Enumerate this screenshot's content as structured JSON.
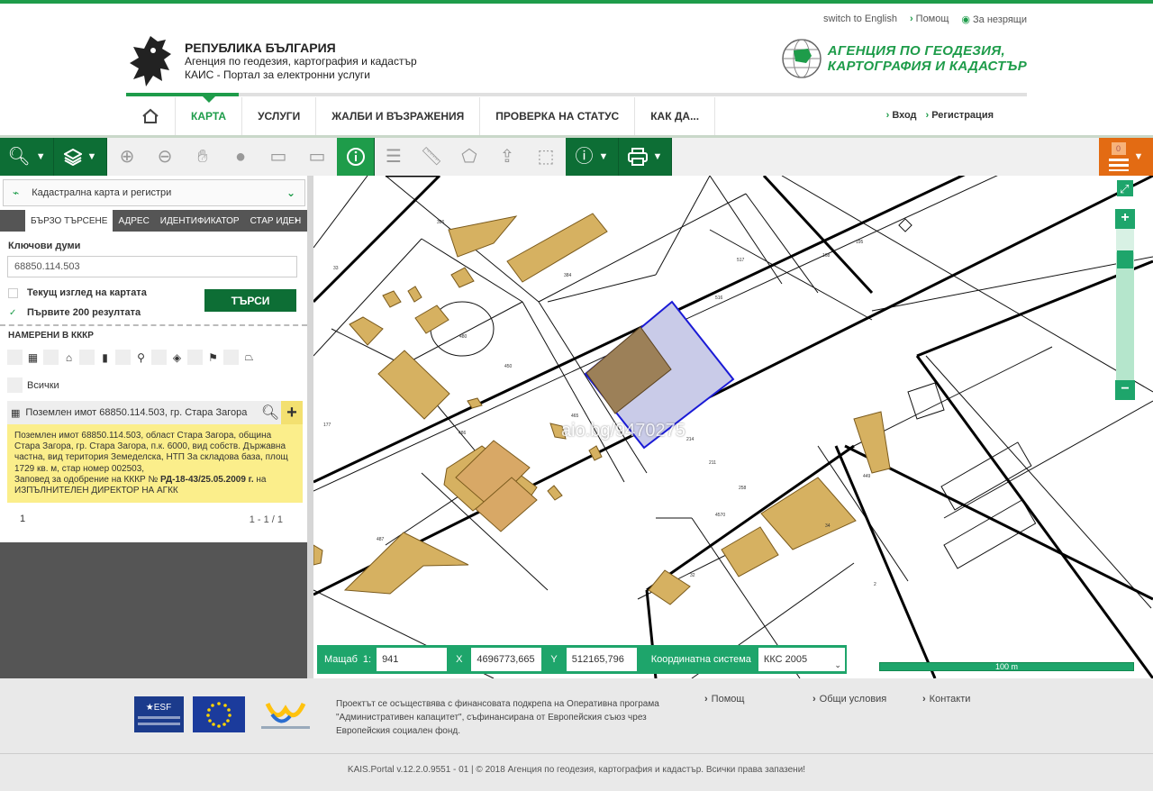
{
  "util_links": [
    {
      "label": "switch to English"
    },
    {
      "label": "Помощ"
    },
    {
      "label": "За незрящи"
    }
  ],
  "brand": {
    "line1": "РЕПУБЛИКА БЪЛГАРИЯ",
    "line2": "Агенция по геодезия, картография и кадастър",
    "line3": "КАИС - Портал за електронни услуги",
    "agency_line1": "АГЕНЦИЯ ПО ГЕОДЕЗИЯ,",
    "agency_line2": "КАРТОГРАФИЯ И КАДАСТЪР"
  },
  "nav": {
    "items": [
      {
        "label": "КАРТА",
        "active": true
      },
      {
        "label": "УСЛУГИ"
      },
      {
        "label": "ЖАЛБИ И ВЪЗРАЖЕНИЯ"
      },
      {
        "label": "ПРОВЕРКА НА СТАТУС"
      },
      {
        "label": "КАК ДА..."
      }
    ],
    "login": "Вход",
    "register": "Регистрация"
  },
  "toolbar": {
    "basket_count": "0"
  },
  "panel": {
    "layer_select": "Кадастрална карта и регистри",
    "tabs": [
      "БЪРЗО ТЪРСЕНЕ",
      "АДРЕС",
      "ИДЕНТИФИКАТОР",
      "СТАР ИДЕН"
    ],
    "keywords_label": "Ключови думи",
    "keywords_value": "68850.114.503",
    "current_view_label": "Текущ изглед на картата",
    "first200_label": "Първите 200 резултата",
    "search_button": "ТЪРСИ",
    "found_label": "НАМЕРЕНИ В КККР",
    "all_label": "Всички",
    "result_title": "Поземлен имот 68850.114.503, гр. Стара Загора",
    "result_desc_1": "Поземлен имот 68850.114.503, област Стара Загора, община Стара Загора, гр. Стара Загора, п.к. 6000, вид собств. Държавна частна, вид територия Земеделска, НТП За складова база, площ 1729 кв. м, стар номер 002503,",
    "result_desc_2a": "Заповед за одобрение на КККР №",
    "result_desc_2b": "РД-18-43/25.05.2009 г.",
    "result_desc_2c": "на",
    "result_desc_3": "ИЗПЪЛНИТЕЛЕН ДИРЕКТОР НА АГКК",
    "page": "1",
    "page_range": "1 - 1 / 1"
  },
  "map": {
    "watermark": "aio.bg/9470275",
    "scale_label": "Мащаб",
    "scale_prefix": "1:",
    "scale_value": "941",
    "x_label": "X",
    "x_value": "4696773,665",
    "y_label": "Y",
    "y_value": "512165,796",
    "crs_label": "Координатна система",
    "crs_value": "ККС 2005",
    "scalebar": "100 m"
  },
  "footer": {
    "text": "Проектът се осъществява с финансовата подкрепа на Оперативна програма \"Административен капацитет\", съфинансирана от Европейския съюз чрез Европейския социален фонд.",
    "links": [
      "Помощ",
      "Общи условия",
      "Контакти"
    ],
    "copyright": "KAIS.Portal v.12.2.0.9551 - 01  |  © 2018 Агенция по геодезия, картография и кадастър. Всички права запазени!"
  },
  "colors": {
    "brand_green": "#1e9c4a",
    "dark_green": "#0d6e35",
    "orange": "#e36b13",
    "highlight_fill": "#c9cbe8",
    "building_fill": "#d6b161"
  }
}
